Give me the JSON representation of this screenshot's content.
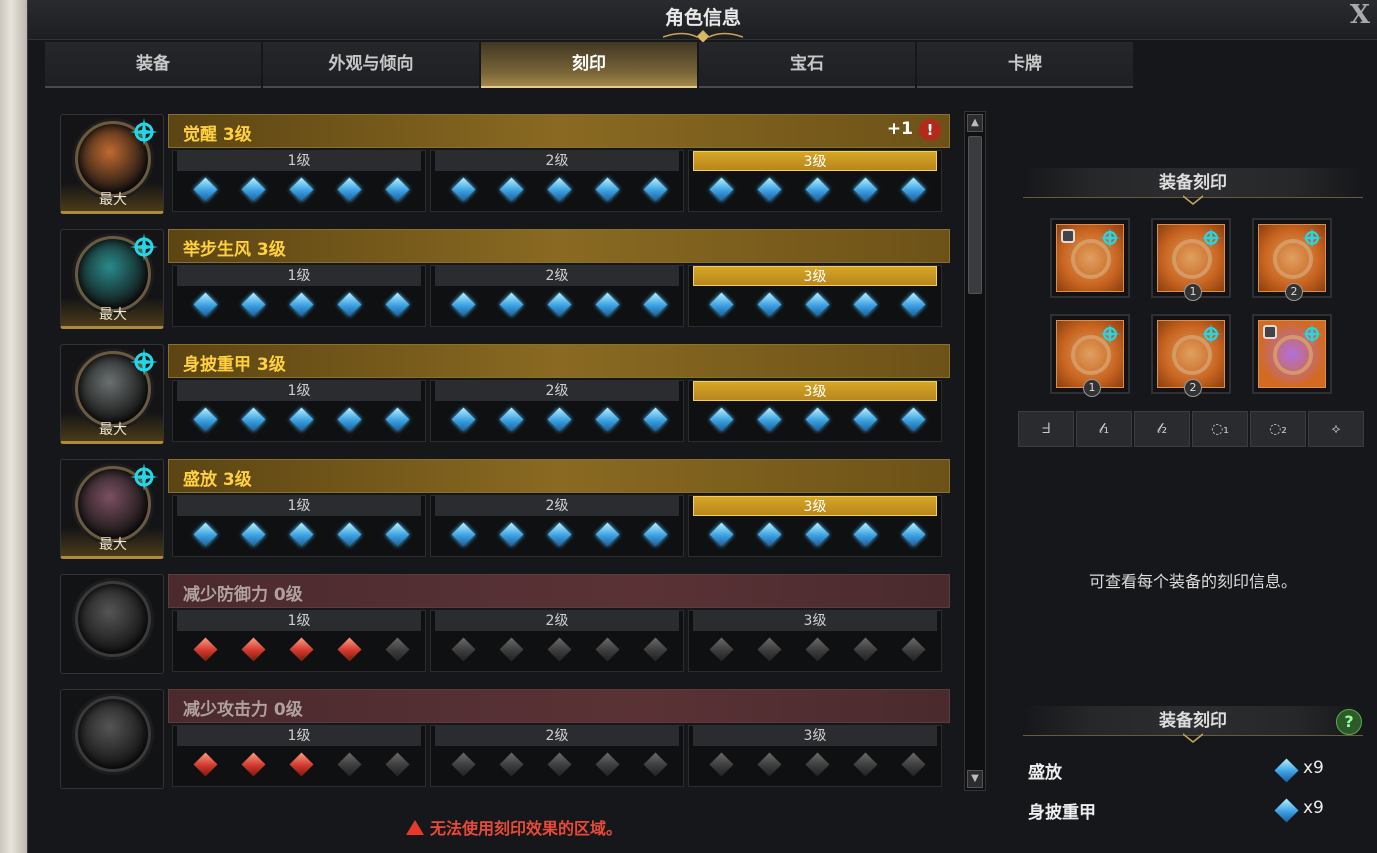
{
  "window": {
    "title": "角色信息",
    "close_glyph": "X"
  },
  "tabs": [
    {
      "label": "装备"
    },
    {
      "label": "外观与倾向"
    },
    {
      "label": "刻印"
    },
    {
      "label": "宝石"
    },
    {
      "label": "卡牌"
    }
  ],
  "engravings": [
    {
      "name": "觉醒 3级",
      "max_label": "最大",
      "active": true,
      "plus": "+1",
      "alert": "!",
      "orb": "#c06a30",
      "level_on": 3,
      "filled": 15,
      "levels": [
        "1级",
        "2级",
        "3级"
      ]
    },
    {
      "name": "举步生风 3级",
      "max_label": "最大",
      "active": true,
      "orb": "#2a8a8a",
      "level_on": 3,
      "filled": 15,
      "levels": [
        "1级",
        "2级",
        "3级"
      ]
    },
    {
      "name": "身披重甲 3级",
      "max_label": "最大",
      "active": true,
      "orb": "#6a7070",
      "level_on": 3,
      "filled": 15,
      "levels": [
        "1级",
        "2级",
        "3级"
      ]
    },
    {
      "name": "盛放 3级",
      "max_label": "最大",
      "active": true,
      "orb": "#7a5060",
      "level_on": 3,
      "filled": 15,
      "levels": [
        "1级",
        "2级",
        "3级"
      ]
    },
    {
      "name": "减少防御力 0级",
      "active": false,
      "orb": "#555",
      "red": 4,
      "levels": [
        "1级",
        "2级",
        "3级"
      ]
    },
    {
      "name": "减少攻击力 0级",
      "active": false,
      "orb": "#555",
      "red": 3,
      "levels": [
        "1级",
        "2级",
        "3级"
      ]
    }
  ],
  "warning": "无法使用刻印效果的区域。",
  "right": {
    "section_title": "装备刻印",
    "slots": [
      {
        "locked": true,
        "num": ""
      },
      {
        "locked": false,
        "num": "1"
      },
      {
        "locked": false,
        "num": "2"
      },
      {
        "locked": false,
        "num": "1"
      },
      {
        "locked": false,
        "num": "2"
      },
      {
        "locked": true,
        "num": "",
        "purple": true
      }
    ],
    "filters": [
      "neck-icon",
      "earring-1-icon",
      "earring-2-icon",
      "ring-1-icon",
      "ring-2-icon",
      "stone-icon"
    ],
    "filter_glyphs": [
      "ᖵ",
      "𝓁₁",
      "𝓁₂",
      "◌₁",
      "◌₂",
      "⟡"
    ],
    "hint": "可查看每个装备的刻印信息。",
    "summary_title": "装备刻印",
    "help": "?",
    "summary": [
      {
        "name": "盛放",
        "count": "x9"
      },
      {
        "name": "身披重甲",
        "count": "x9"
      }
    ]
  }
}
